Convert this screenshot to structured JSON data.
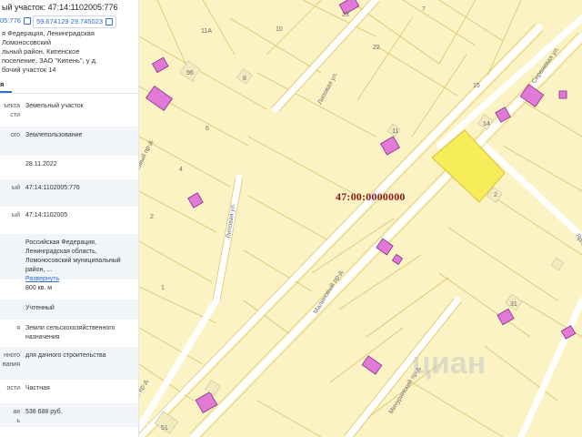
{
  "header": {
    "title_fragment": "ый участок: 47:14:1102005:776",
    "cad_chip": "05:776",
    "coords_chip": "59.674129 29.745023"
  },
  "address_lines": [
    "я Федерация, Ленинградская",
    "Ломоносовский",
    "льный район, Кипенское",
    "поселение, ЗАО \"Кипень\", у д.",
    "бочий участок 14"
  ],
  "tab_label": "я",
  "rows": [
    {
      "label": "ъекта\nсти",
      "value": "Земельный участок",
      "shaded": false
    },
    {
      "label": "ого",
      "value": "Землепользование",
      "shaded": true
    },
    {
      "label": "",
      "value": "28.11.2022",
      "shaded": false
    },
    {
      "label": "ый",
      "value": "47:14:1102005:776",
      "shaded": true
    },
    {
      "label": "ый",
      "value": "47:14:1102005",
      "shaded": false
    },
    {
      "label": "",
      "value": "Российская Федерация, Ленинградская область, Ломоносовский муниципальный район, ...",
      "link": "Развернуть",
      "shaded": true
    },
    {
      "label": "",
      "value": "800 кв. м",
      "shaded": false
    },
    {
      "label": "",
      "value": "Учтенный",
      "shaded": true
    },
    {
      "label": "я",
      "value": "Земли сельскохозяйственного назначения",
      "shaded": false
    },
    {
      "label": "нного\nвания",
      "value": "для дачного строительства",
      "shaded": true
    },
    {
      "label": "ости",
      "value": "Частная",
      "shaded": false
    },
    {
      "label": "ая\nь",
      "value": "538 688 руб.",
      "shaded": true
    }
  ],
  "map": {
    "cadastral_label": "47:00:0000000",
    "watermark": "циан",
    "lot_numbers": [
      "23",
      "7",
      "11А",
      "10",
      "22",
      "15",
      "96",
      "8",
      "14",
      "6",
      "11",
      "4",
      "2",
      "2",
      "1",
      "51",
      "31"
    ],
    "streets": [
      "Липовая ул.",
      "Липовая ул.",
      "Сиреневая ул.",
      "Малиновый пр-д.",
      "Мичуринский пр-д.",
      "Дачный пр-д.",
      "Сосновый пр-д.",
      "Ярла"
    ],
    "colors": {
      "background": "#fbf3c4",
      "parcel_line": "#d9c46a",
      "road": "#ffffff",
      "building": "#e07ad6",
      "selected": "#f7ec5a",
      "label_red": "#8b1a1a"
    }
  }
}
